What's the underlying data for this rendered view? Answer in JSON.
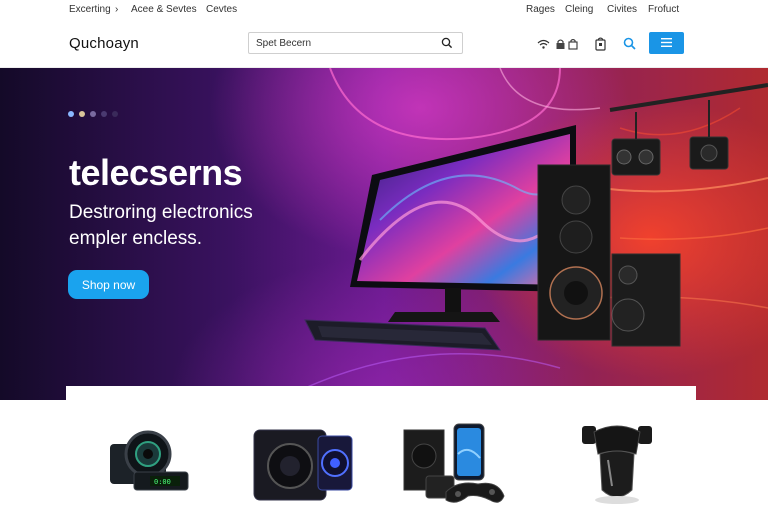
{
  "utility_bar": {
    "left": [
      "Excerting",
      "›",
      "Acee & Sevtes",
      "Cevtes"
    ],
    "right": [
      "Rages",
      "Cleing",
      "Civites",
      "Frofuct"
    ]
  },
  "header": {
    "logo": "Quchoayn",
    "search": {
      "value": "",
      "placeholder": "Spet Becern"
    },
    "icons": [
      "wifi-icon",
      "lock-icon",
      "cart-icon",
      "search-icon",
      "menu-icon"
    ]
  },
  "hero": {
    "carousel_dots": 5,
    "active_dot": 0,
    "title": "telecserns",
    "subtitle_line1": "Destroring electronics",
    "subtitle_line2": "empler encless.",
    "cta_label": "Shop now"
  },
  "products": [
    {
      "name": "camera-device"
    },
    {
      "name": "speaker-cube"
    },
    {
      "name": "phone-speaker-controller"
    },
    {
      "name": "phone-holder"
    }
  ],
  "colors": {
    "accent": "#1a95e6",
    "cta": "#1aa3ee",
    "hero_dark": "#140a28",
    "hero_purple": "#6a1a90",
    "hero_red": "#b02a30"
  }
}
